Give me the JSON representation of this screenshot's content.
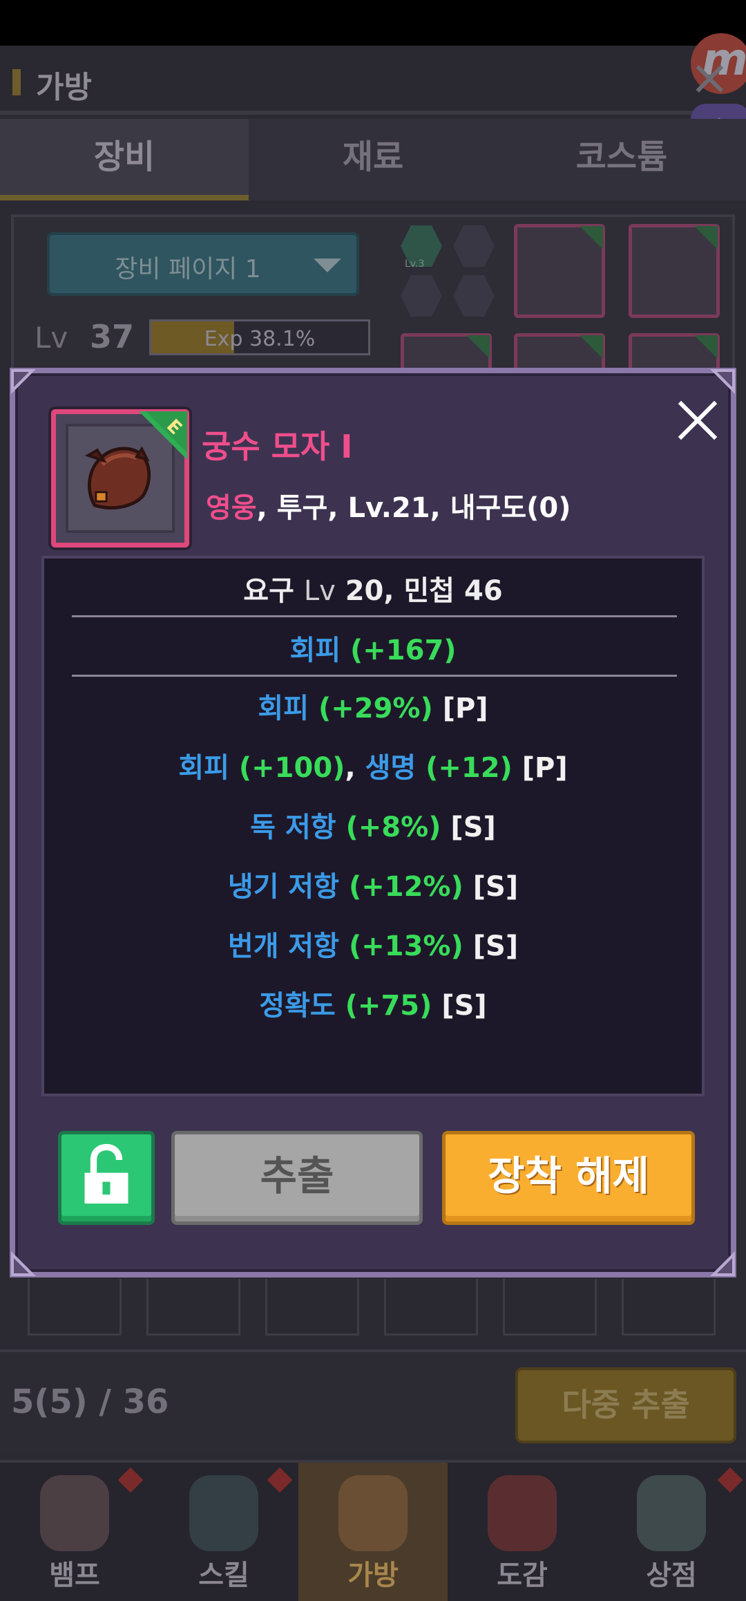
{
  "background": {
    "title": "가방",
    "tabs": [
      "장비",
      "재료",
      "코스튬"
    ],
    "page_select": "장비 페이지 1",
    "level_label": "Lv",
    "level_value": "37",
    "exp_text": "Exp 38.1%",
    "exp_percent": 38.1,
    "slot_level": "Lv.3",
    "inventory_count": "5(5) / 36",
    "multi_extract_label": "다중 추출"
  },
  "nav": [
    {
      "label": "뱀프",
      "icon": "vampire-icon"
    },
    {
      "label": "스킬",
      "icon": "skill-orbs-icon"
    },
    {
      "label": "가방",
      "icon": "backpack-icon"
    },
    {
      "label": "도감",
      "icon": "book-icon"
    },
    {
      "label": "상점",
      "icon": "shop-icon"
    }
  ],
  "modal": {
    "item_name": "궁수 모자 Ⅰ",
    "rarity": "영웅",
    "meta_rest": ", 투구, Lv.21, 내구도(0)",
    "grade_letter": "E",
    "req": {
      "prefix": "요구 ",
      "lv_label": "Lv",
      "text": " 20, 민첩 46"
    },
    "base_stat": {
      "name": "회피",
      "value": "(+167)"
    },
    "stats": [
      {
        "parts": [
          {
            "t": "회피 ",
            "c": "blue"
          },
          {
            "t": "(+29%)",
            "c": "green"
          },
          {
            "t": " [P]",
            "c": "white"
          }
        ]
      },
      {
        "parts": [
          {
            "t": "회피 ",
            "c": "blue"
          },
          {
            "t": "(+100)",
            "c": "green"
          },
          {
            "t": ", ",
            "c": "white"
          },
          {
            "t": "생명 ",
            "c": "blue"
          },
          {
            "t": "(+12)",
            "c": "green"
          },
          {
            "t": " [P]",
            "c": "white"
          }
        ]
      },
      {
        "parts": [
          {
            "t": "독 저항 ",
            "c": "blue"
          },
          {
            "t": "(+8%)",
            "c": "green"
          },
          {
            "t": " [S]",
            "c": "white"
          }
        ]
      },
      {
        "parts": [
          {
            "t": "냉기 저항 ",
            "c": "blue"
          },
          {
            "t": "(+12%)",
            "c": "green"
          },
          {
            "t": " [S]",
            "c": "white"
          }
        ]
      },
      {
        "parts": [
          {
            "t": "번개 저항 ",
            "c": "blue"
          },
          {
            "t": "(+13%)",
            "c": "green"
          },
          {
            "t": " [S]",
            "c": "white"
          }
        ]
      },
      {
        "parts": [
          {
            "t": "정확도 ",
            "c": "blue"
          },
          {
            "t": "(+75)",
            "c": "green"
          },
          {
            "t": " [S]",
            "c": "white"
          }
        ]
      }
    ],
    "extract_label": "추출",
    "unequip_label": "장착 해제"
  }
}
